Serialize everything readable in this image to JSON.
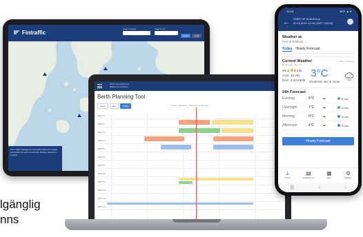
{
  "tablet": {
    "brand": "Fintraffic",
    "field_labels": [
      "Search vessel",
      "Search port"
    ],
    "buttons": [
      "Search",
      "Clear"
    ],
    "panel_text": "Port Traffic Management provides berth and vessel information for ports and for the fairway network in Finland."
  },
  "laptop": {
    "port_line1": "PORT OF KOKKOLA",
    "port_line2": "BERTH PLANNING",
    "title": "Berth Planning Tool",
    "view_tabs": [
      "Week",
      "Day",
      "Today"
    ],
    "legend": [
      "Arrival",
      "Departure",
      "Planned",
      "Confirmed"
    ],
    "rows": [
      "BERTH 1",
      "BERTH 2",
      "BERTH 3",
      "BERTH 4",
      "BERTH 5",
      "BERTH 6",
      "BERTH 7",
      "BERTH 8",
      "BERTH 9",
      "BERTH 10",
      "BERTH 11",
      "BERTH 12"
    ],
    "bar_colors": {
      "orange": "#f4a381",
      "green": "#8fd18f",
      "yellow": "#f7e08a",
      "blue": "#9cbdf0"
    }
  },
  "phone": {
    "status_time": "12:18",
    "status_right": "36°F ▲ 9",
    "port": "PORT OF KOKKOLA",
    "datetime": "20.10.2021 12:18 (GMT +03:00)",
    "weather_at": "Weather at",
    "location": "Port of Kokkola",
    "tabs": [
      "Today",
      "Hourly Forecast"
    ],
    "current_title": "Current Weather",
    "updated": "12:00 (Updated)",
    "subtitle": "Wednesday, Nov 15",
    "wind_label": "Wind",
    "wind_value": "8 m/s",
    "gust_label": "Gust",
    "gust_value": "12 m/s",
    "rain_label": "Rain",
    "rain_value": "2.23 mm/h",
    "temperature": "3°C",
    "condition": "Moderate rain & snow",
    "forecast_title": "24h Forecast",
    "forecast": [
      {
        "name": "Evening",
        "temp": "5°C",
        "wind": "6 m/s",
        "dot": "#54b85a"
      },
      {
        "name": "Overnight",
        "temp": "7°C",
        "wind": "4 m/s",
        "dot": "#54b85a"
      },
      {
        "name": "Morning",
        "temp": "5°C",
        "wind": "3 m/s",
        "dot": "#3d7fd9"
      },
      {
        "name": "Afternoon",
        "temp": "4°C",
        "wind": "3 m/s",
        "dot": "#3d7fd9"
      }
    ],
    "button": "Hourly Forecast",
    "nav": [
      "Arrival",
      "Notifications",
      "Map",
      "Settings"
    ]
  },
  "side_text": [
    "lgänglig",
    "nns"
  ]
}
